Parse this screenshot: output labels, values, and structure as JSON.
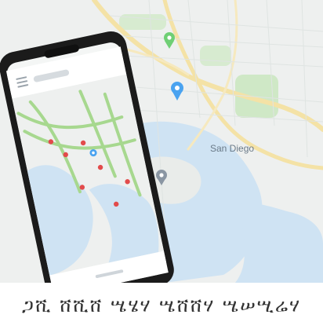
{
  "map": {
    "place_labels": [
      "San Diego"
    ],
    "palette": {
      "water": "#cfe3f3",
      "land": "#eef0ef",
      "park": "#cfe8c6",
      "road_yellow": "#f4e2a6",
      "pin_blue": "#4aa3f0",
      "pin_green": "#6fcf75",
      "phone_body": "#1b1b1b"
    }
  },
  "phone": {
    "icons": [
      "map-pin-icon",
      "navigation-dot-icon",
      "menu-icon"
    ]
  },
  "caption": {
    "text": "ጋሺ ሸሺሸ ሤሄሃ ሤሸሸሃ ሤሠሢሬሃ"
  }
}
